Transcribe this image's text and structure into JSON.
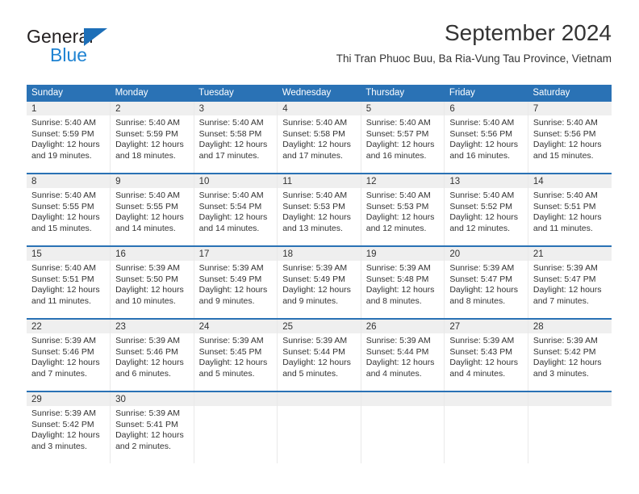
{
  "brand": {
    "name_top": "General",
    "name_bottom": "Blue",
    "accent_color": "#1f83d2",
    "triangle_color": "#1d6fb8",
    "logo_icon": "triangle-play-icon"
  },
  "header": {
    "title": "September 2024",
    "subtitle": "Thi Tran Phuoc Buu, Ba Ria-Vung Tau Province, Vietnam"
  },
  "calendar": {
    "header_bg": "#2a72b5",
    "header_text_color": "#ffffff",
    "daynum_band_bg": "#efefef",
    "weekdays": [
      "Sunday",
      "Monday",
      "Tuesday",
      "Wednesday",
      "Thursday",
      "Friday",
      "Saturday"
    ],
    "weeks": [
      [
        {
          "day": "1",
          "sunrise": "Sunrise: 5:40 AM",
          "sunset": "Sunset: 5:59 PM",
          "daylight1": "Daylight: 12 hours",
          "daylight2": "and 19 minutes."
        },
        {
          "day": "2",
          "sunrise": "Sunrise: 5:40 AM",
          "sunset": "Sunset: 5:59 PM",
          "daylight1": "Daylight: 12 hours",
          "daylight2": "and 18 minutes."
        },
        {
          "day": "3",
          "sunrise": "Sunrise: 5:40 AM",
          "sunset": "Sunset: 5:58 PM",
          "daylight1": "Daylight: 12 hours",
          "daylight2": "and 17 minutes."
        },
        {
          "day": "4",
          "sunrise": "Sunrise: 5:40 AM",
          "sunset": "Sunset: 5:58 PM",
          "daylight1": "Daylight: 12 hours",
          "daylight2": "and 17 minutes."
        },
        {
          "day": "5",
          "sunrise": "Sunrise: 5:40 AM",
          "sunset": "Sunset: 5:57 PM",
          "daylight1": "Daylight: 12 hours",
          "daylight2": "and 16 minutes."
        },
        {
          "day": "6",
          "sunrise": "Sunrise: 5:40 AM",
          "sunset": "Sunset: 5:56 PM",
          "daylight1": "Daylight: 12 hours",
          "daylight2": "and 16 minutes."
        },
        {
          "day": "7",
          "sunrise": "Sunrise: 5:40 AM",
          "sunset": "Sunset: 5:56 PM",
          "daylight1": "Daylight: 12 hours",
          "daylight2": "and 15 minutes."
        }
      ],
      [
        {
          "day": "8",
          "sunrise": "Sunrise: 5:40 AM",
          "sunset": "Sunset: 5:55 PM",
          "daylight1": "Daylight: 12 hours",
          "daylight2": "and 15 minutes."
        },
        {
          "day": "9",
          "sunrise": "Sunrise: 5:40 AM",
          "sunset": "Sunset: 5:55 PM",
          "daylight1": "Daylight: 12 hours",
          "daylight2": "and 14 minutes."
        },
        {
          "day": "10",
          "sunrise": "Sunrise: 5:40 AM",
          "sunset": "Sunset: 5:54 PM",
          "daylight1": "Daylight: 12 hours",
          "daylight2": "and 14 minutes."
        },
        {
          "day": "11",
          "sunrise": "Sunrise: 5:40 AM",
          "sunset": "Sunset: 5:53 PM",
          "daylight1": "Daylight: 12 hours",
          "daylight2": "and 13 minutes."
        },
        {
          "day": "12",
          "sunrise": "Sunrise: 5:40 AM",
          "sunset": "Sunset: 5:53 PM",
          "daylight1": "Daylight: 12 hours",
          "daylight2": "and 12 minutes."
        },
        {
          "day": "13",
          "sunrise": "Sunrise: 5:40 AM",
          "sunset": "Sunset: 5:52 PM",
          "daylight1": "Daylight: 12 hours",
          "daylight2": "and 12 minutes."
        },
        {
          "day": "14",
          "sunrise": "Sunrise: 5:40 AM",
          "sunset": "Sunset: 5:51 PM",
          "daylight1": "Daylight: 12 hours",
          "daylight2": "and 11 minutes."
        }
      ],
      [
        {
          "day": "15",
          "sunrise": "Sunrise: 5:40 AM",
          "sunset": "Sunset: 5:51 PM",
          "daylight1": "Daylight: 12 hours",
          "daylight2": "and 11 minutes."
        },
        {
          "day": "16",
          "sunrise": "Sunrise: 5:39 AM",
          "sunset": "Sunset: 5:50 PM",
          "daylight1": "Daylight: 12 hours",
          "daylight2": "and 10 minutes."
        },
        {
          "day": "17",
          "sunrise": "Sunrise: 5:39 AM",
          "sunset": "Sunset: 5:49 PM",
          "daylight1": "Daylight: 12 hours",
          "daylight2": "and 9 minutes."
        },
        {
          "day": "18",
          "sunrise": "Sunrise: 5:39 AM",
          "sunset": "Sunset: 5:49 PM",
          "daylight1": "Daylight: 12 hours",
          "daylight2": "and 9 minutes."
        },
        {
          "day": "19",
          "sunrise": "Sunrise: 5:39 AM",
          "sunset": "Sunset: 5:48 PM",
          "daylight1": "Daylight: 12 hours",
          "daylight2": "and 8 minutes."
        },
        {
          "day": "20",
          "sunrise": "Sunrise: 5:39 AM",
          "sunset": "Sunset: 5:47 PM",
          "daylight1": "Daylight: 12 hours",
          "daylight2": "and 8 minutes."
        },
        {
          "day": "21",
          "sunrise": "Sunrise: 5:39 AM",
          "sunset": "Sunset: 5:47 PM",
          "daylight1": "Daylight: 12 hours",
          "daylight2": "and 7 minutes."
        }
      ],
      [
        {
          "day": "22",
          "sunrise": "Sunrise: 5:39 AM",
          "sunset": "Sunset: 5:46 PM",
          "daylight1": "Daylight: 12 hours",
          "daylight2": "and 7 minutes."
        },
        {
          "day": "23",
          "sunrise": "Sunrise: 5:39 AM",
          "sunset": "Sunset: 5:46 PM",
          "daylight1": "Daylight: 12 hours",
          "daylight2": "and 6 minutes."
        },
        {
          "day": "24",
          "sunrise": "Sunrise: 5:39 AM",
          "sunset": "Sunset: 5:45 PM",
          "daylight1": "Daylight: 12 hours",
          "daylight2": "and 5 minutes."
        },
        {
          "day": "25",
          "sunrise": "Sunrise: 5:39 AM",
          "sunset": "Sunset: 5:44 PM",
          "daylight1": "Daylight: 12 hours",
          "daylight2": "and 5 minutes."
        },
        {
          "day": "26",
          "sunrise": "Sunrise: 5:39 AM",
          "sunset": "Sunset: 5:44 PM",
          "daylight1": "Daylight: 12 hours",
          "daylight2": "and 4 minutes."
        },
        {
          "day": "27",
          "sunrise": "Sunrise: 5:39 AM",
          "sunset": "Sunset: 5:43 PM",
          "daylight1": "Daylight: 12 hours",
          "daylight2": "and 4 minutes."
        },
        {
          "day": "28",
          "sunrise": "Sunrise: 5:39 AM",
          "sunset": "Sunset: 5:42 PM",
          "daylight1": "Daylight: 12 hours",
          "daylight2": "and 3 minutes."
        }
      ],
      [
        {
          "day": "29",
          "sunrise": "Sunrise: 5:39 AM",
          "sunset": "Sunset: 5:42 PM",
          "daylight1": "Daylight: 12 hours",
          "daylight2": "and 3 minutes."
        },
        {
          "day": "30",
          "sunrise": "Sunrise: 5:39 AM",
          "sunset": "Sunset: 5:41 PM",
          "daylight1": "Daylight: 12 hours",
          "daylight2": "and 2 minutes."
        },
        {
          "day": "",
          "sunrise": "",
          "sunset": "",
          "daylight1": "",
          "daylight2": ""
        },
        {
          "day": "",
          "sunrise": "",
          "sunset": "",
          "daylight1": "",
          "daylight2": ""
        },
        {
          "day": "",
          "sunrise": "",
          "sunset": "",
          "daylight1": "",
          "daylight2": ""
        },
        {
          "day": "",
          "sunrise": "",
          "sunset": "",
          "daylight1": "",
          "daylight2": ""
        },
        {
          "day": "",
          "sunrise": "",
          "sunset": "",
          "daylight1": "",
          "daylight2": ""
        }
      ]
    ]
  }
}
